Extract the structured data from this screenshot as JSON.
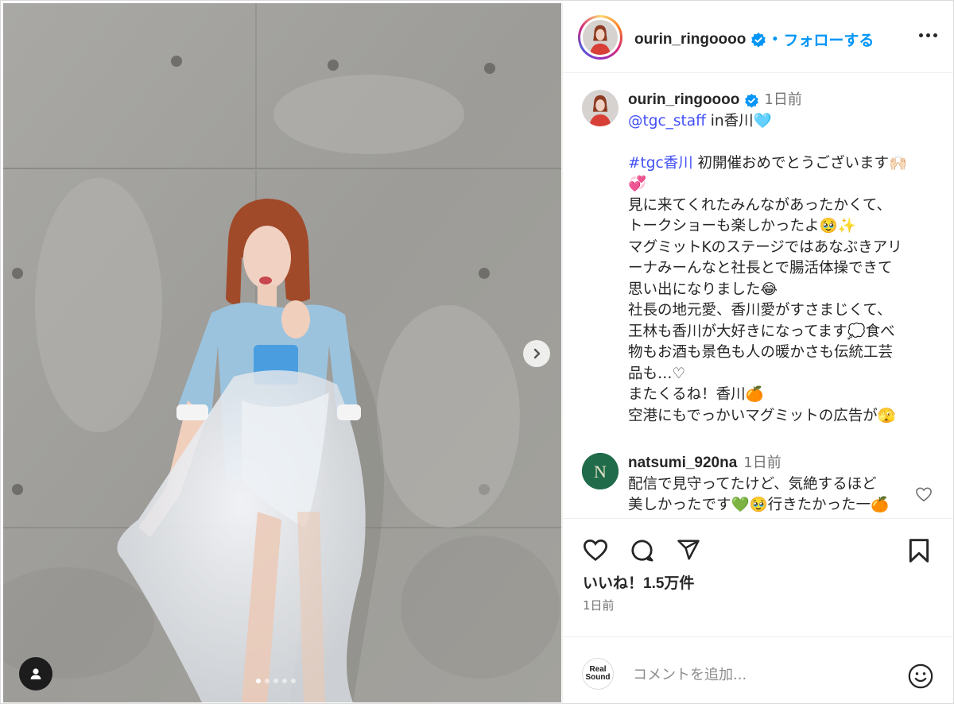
{
  "post": {
    "author": "ourin_ringoooo",
    "follow_separator": "•",
    "follow_label": "フォローする"
  },
  "caption": {
    "author": "ourin_ringoooo",
    "time": "1日前",
    "lines": [
      {
        "mention": "@tgc_staff",
        "text": " in香川🩵"
      },
      {
        "hashtag": "#tgc香川",
        "text": " 初開催おめでとうございます🙌🏻"
      },
      "💞",
      "見に来てくれたみんながあったかくて、",
      "トークショーも楽しかったよ🥹✨",
      "マグミットKのステージではあなぶきアリ",
      "ーナみーんなと社長とで腸活体操できて",
      "思い出になりました😂",
      "社長の地元愛、香川愛がすさまじくて、",
      "王林も香川が大好きになってます💭食べ",
      "物もお酒も景色も人の暖かさも伝統工芸",
      "品も…♡",
      "またくるね！香川🍊",
      "空港にもでっかいマグミットの広告が🫣"
    ]
  },
  "comment": {
    "author": "natsumi_920na",
    "time": "1日前",
    "lines": [
      "配信で見守ってたけど、気絶するほど",
      "美しかったです💚🥹行きたかった一🍊"
    ]
  },
  "engagement": {
    "likes": "いいね！1.5万件",
    "date": "1日前"
  },
  "comment_box": {
    "logo_line1": "Real",
    "logo_line2": "Sound",
    "placeholder": "コメントを追加..."
  },
  "carousel": {
    "slides": 5,
    "active": 0
  },
  "colors": {
    "link": "#0095f6",
    "mention": "#4150f7",
    "verified": "#0095f6",
    "muted": "#737373"
  },
  "icons": [
    "verified-icon",
    "more-icon",
    "heart-icon",
    "comment-icon",
    "share-icon",
    "bookmark-icon",
    "emoji-icon",
    "chevron-right-icon",
    "user-tag-icon"
  ]
}
